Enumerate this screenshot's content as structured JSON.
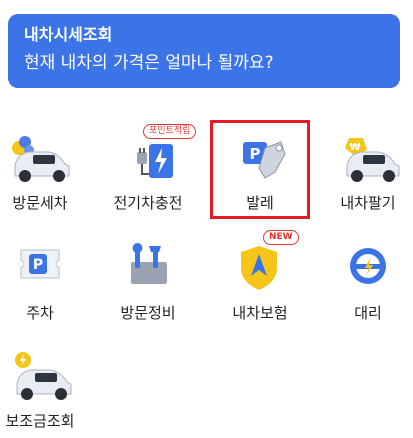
{
  "banner": {
    "title": "내차시세조회",
    "subtitle": "현재 내차의 가격은 얼마나 될까요?"
  },
  "tiles": [
    {
      "label": "방문세차",
      "icon": "car-wash-icon"
    },
    {
      "label": "전기차충전",
      "icon": "ev-charge-icon",
      "badge": "포인트적립"
    },
    {
      "label": "발레",
      "icon": "valet-key-icon"
    },
    {
      "label": "내차팔기",
      "icon": "sell-car-icon"
    },
    {
      "label": "주차",
      "icon": "parking-ticket-icon"
    },
    {
      "label": "방문정비",
      "icon": "toolbox-icon"
    },
    {
      "label": "내차보험",
      "icon": "insurance-shield-icon",
      "badge": "NEW"
    },
    {
      "label": "대리",
      "icon": "steering-wheel-icon"
    },
    {
      "label": "보조금조회",
      "icon": "subsidy-car-icon"
    }
  ],
  "colors": {
    "banner_bg": "#3b74e6",
    "highlight_border": "#e31c25",
    "badge_red": "#e2362f"
  }
}
